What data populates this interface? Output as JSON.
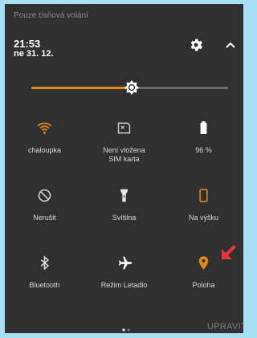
{
  "status": {
    "text": "Pouze tísňová volání"
  },
  "header": {
    "time": "21:53",
    "date": "ne 31. 12."
  },
  "brightness": {
    "level_percent": 51
  },
  "tiles": [
    {
      "id": "wifi",
      "label": "chaloupka",
      "icon": "wifi-icon"
    },
    {
      "id": "sim",
      "label_line1": "Není vložena",
      "label_line2": "SIM karta",
      "icon": "sim-card-icon"
    },
    {
      "id": "battery",
      "label": "96 %",
      "icon": "battery-icon"
    },
    {
      "id": "dnd",
      "label": "Nerušit",
      "icon": "do-not-disturb-icon"
    },
    {
      "id": "flashlight",
      "label": "Svítilna",
      "icon": "flashlight-icon"
    },
    {
      "id": "rotate",
      "label": "Na výšku",
      "icon": "portrait-rotation-icon"
    },
    {
      "id": "bluetooth",
      "label": "Bluetooth",
      "icon": "bluetooth-icon"
    },
    {
      "id": "airplane",
      "label": "Režim Letadlo",
      "icon": "airplane-icon"
    },
    {
      "id": "location",
      "label": "Poloha",
      "icon": "location-pin-icon"
    }
  ],
  "footer": {
    "edit_label": "UPRAVIT",
    "page_count": 2,
    "current_page": 1
  },
  "colors": {
    "accent": "#e08a18",
    "panel_bg": "#303030",
    "frame_bg": "#a9dff2",
    "arrow": "#e8323c"
  }
}
